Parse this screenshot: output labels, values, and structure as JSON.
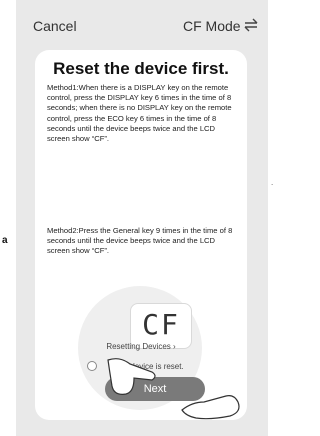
{
  "header": {
    "cancel": "Cancel",
    "mode": "CF Mode",
    "swap_icon": "swap-arrows-icon"
  },
  "card": {
    "title": "Reset the device first.",
    "method1": "Method1:When there is a DISPLAY key on the remote control, press the DISPLAY key 6 times in the time of 8 seconds; when there is no DISPLAY key on the remote control, press the ECO key 6 times in the time of 8 seconds until the device beeps twice and the LCD screen show “CF”.",
    "method2": "Method2:Press the General key 9 times in the time of 8 seconds until the device beeps twice and the LCD screen show “CF”.",
    "lcd_text": "CF",
    "resetting": "Resetting Devices ›",
    "confirm": "the device is reset.",
    "next": "Next"
  },
  "side_label": "a"
}
